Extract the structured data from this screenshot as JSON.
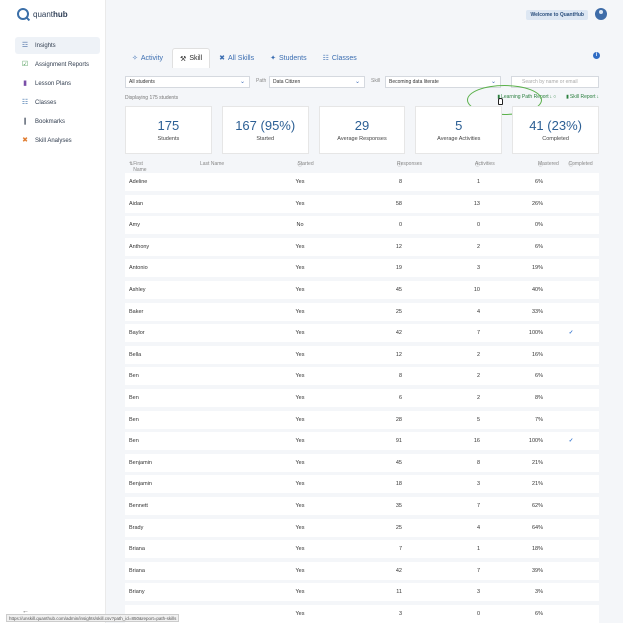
{
  "brand": {
    "name_a": "quant",
    "name_b": "hub"
  },
  "sidebar": {
    "items": [
      {
        "label": "Insights",
        "icon": "chart-icon",
        "glyph": "☲"
      },
      {
        "label": "Assignment Reports",
        "icon": "assignment-icon",
        "glyph": "☑"
      },
      {
        "label": "Lesson Plans",
        "icon": "book-icon",
        "glyph": "▮"
      },
      {
        "label": "Classes",
        "icon": "classes-icon",
        "glyph": "☷"
      },
      {
        "label": "Bookmarks",
        "icon": "bookmark-icon",
        "glyph": "❙"
      },
      {
        "label": "Skill Analyses",
        "icon": "skill-icon",
        "glyph": "✖"
      }
    ]
  },
  "topbar": {
    "welcome": "Welcome to QuantHub"
  },
  "tabs": [
    {
      "label": "Activity",
      "glyph": "✧"
    },
    {
      "label": "Skill",
      "glyph": "⚒"
    },
    {
      "label": "All Skills",
      "glyph": "✖"
    },
    {
      "label": "Students",
      "glyph": "✦"
    },
    {
      "label": "Classes",
      "glyph": "☷"
    }
  ],
  "info": "i",
  "filters": {
    "students": "All students",
    "path_label": "Path",
    "path": "Data Citizen",
    "skill_label": "Skill",
    "skill": "Becoming data literate",
    "search_placeholder": "Search by name or email"
  },
  "displaying": "Displaying 175 students",
  "reports": {
    "learning_path": "Learning Path Report",
    "skill": "Skill Report"
  },
  "stats": [
    {
      "value": "175",
      "label": "Students"
    },
    {
      "value": "167 (95%)",
      "label": "Started"
    },
    {
      "value": "29",
      "label": "Average Responses"
    },
    {
      "value": "5",
      "label": "Average Activities"
    },
    {
      "value": "41 (23%)",
      "label": "Completed"
    }
  ],
  "columns": {
    "first": "First Name",
    "last": "Last Name",
    "started": "Started",
    "responses": "Responses",
    "activities": "Activities",
    "mastered": "Mastered",
    "completed": "Completed"
  },
  "rows": [
    {
      "first": "Adeline",
      "started": "Yes",
      "responses": "8",
      "activities": "1",
      "mastered": "6%",
      "completed": ""
    },
    {
      "first": "Aidan",
      "started": "Yes",
      "responses": "58",
      "activities": "13",
      "mastered": "26%",
      "completed": ""
    },
    {
      "first": "Amy",
      "started": "No",
      "responses": "0",
      "activities": "0",
      "mastered": "0%",
      "completed": ""
    },
    {
      "first": "Anthony",
      "started": "Yes",
      "responses": "12",
      "activities": "2",
      "mastered": "6%",
      "completed": ""
    },
    {
      "first": "Antonio",
      "started": "Yes",
      "responses": "19",
      "activities": "3",
      "mastered": "19%",
      "completed": ""
    },
    {
      "first": "Ashley",
      "started": "Yes",
      "responses": "45",
      "activities": "10",
      "mastered": "40%",
      "completed": ""
    },
    {
      "first": "Baker",
      "started": "Yes",
      "responses": "25",
      "activities": "4",
      "mastered": "33%",
      "completed": ""
    },
    {
      "first": "Baylor",
      "started": "Yes",
      "responses": "42",
      "activities": "7",
      "mastered": "100%",
      "completed": "✓"
    },
    {
      "first": "Bella",
      "started": "Yes",
      "responses": "12",
      "activities": "2",
      "mastered": "16%",
      "completed": ""
    },
    {
      "first": "Ben",
      "started": "Yes",
      "responses": "8",
      "activities": "2",
      "mastered": "6%",
      "completed": ""
    },
    {
      "first": "Ben",
      "started": "Yes",
      "responses": "6",
      "activities": "2",
      "mastered": "8%",
      "completed": ""
    },
    {
      "first": "Ben",
      "started": "Yes",
      "responses": "28",
      "activities": "5",
      "mastered": "7%",
      "completed": ""
    },
    {
      "first": "Ben",
      "started": "Yes",
      "responses": "91",
      "activities": "16",
      "mastered": "100%",
      "completed": "✓"
    },
    {
      "first": "Benjamin",
      "started": "Yes",
      "responses": "45",
      "activities": "8",
      "mastered": "21%",
      "completed": ""
    },
    {
      "first": "Benjamin",
      "started": "Yes",
      "responses": "18",
      "activities": "3",
      "mastered": "21%",
      "completed": ""
    },
    {
      "first": "Bennett",
      "started": "Yes",
      "responses": "35",
      "activities": "7",
      "mastered": "62%",
      "completed": ""
    },
    {
      "first": "Brady",
      "started": "Yes",
      "responses": "25",
      "activities": "4",
      "mastered": "64%",
      "completed": ""
    },
    {
      "first": "Briana",
      "started": "Yes",
      "responses": "7",
      "activities": "1",
      "mastered": "18%",
      "completed": ""
    },
    {
      "first": "Briana",
      "started": "Yes",
      "responses": "42",
      "activities": "7",
      "mastered": "39%",
      "completed": ""
    },
    {
      "first": "Briany",
      "started": "Yes",
      "responses": "11",
      "activities": "3",
      "mastered": "3%",
      "completed": ""
    },
    {
      "first": "",
      "started": "Yes",
      "responses": "3",
      "activities": "0",
      "mastered": "6%",
      "completed": ""
    }
  ],
  "statusbar": "https://unskill.quanthub.com/admin/insights/skill.csv?path_id=850&report=path-skills",
  "colors": {
    "accent": "#2c5f94",
    "link_green": "#2a7f3e",
    "highlight": "#5bb14b",
    "check": "#3c7ad0"
  }
}
